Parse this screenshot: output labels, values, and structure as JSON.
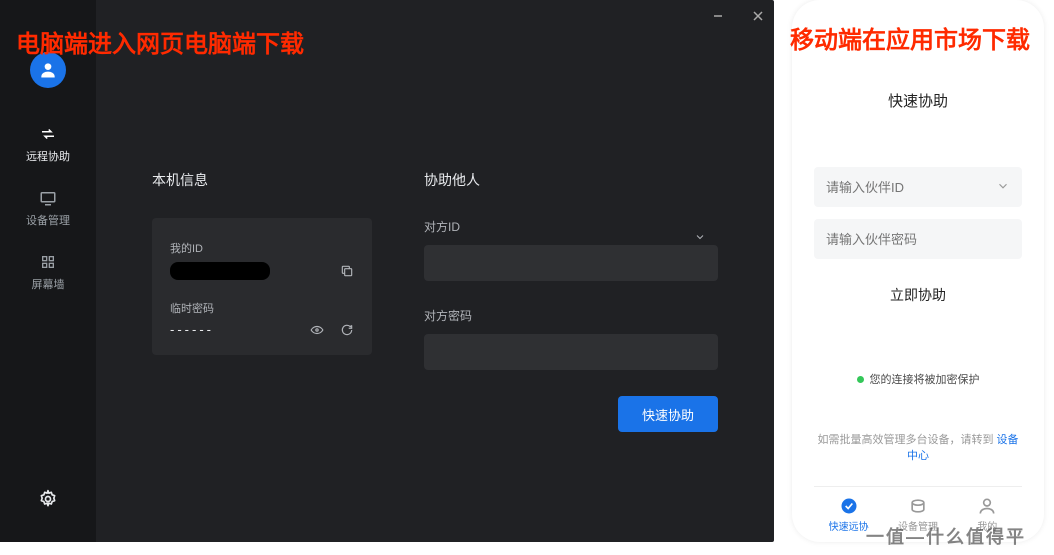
{
  "annotation": {
    "desktop": "电脑端进入网页电脑端下载",
    "mobile": "移动端在应用市场下载"
  },
  "desktop": {
    "sidebar": {
      "items": [
        {
          "label": "远程协助"
        },
        {
          "label": "设备管理"
        },
        {
          "label": "屏幕墙"
        }
      ]
    },
    "local": {
      "title": "本机信息",
      "id_label": "我的ID",
      "pwd_label": "临时密码",
      "pwd_value": "------"
    },
    "assist": {
      "title": "协助他人",
      "id_label": "对方ID",
      "pwd_label": "对方密码",
      "button": "快速协助"
    }
  },
  "mobile": {
    "title": "快速协助",
    "id_placeholder": "请输入伙伴ID",
    "pwd_placeholder": "请输入伙伴密码",
    "button": "立即协助",
    "secure": "您的连接将被加密保护",
    "note_prefix": "如需批量高效管理多台设备，请转到 ",
    "note_link": "设备中心",
    "tabs": [
      {
        "label": "快速远协"
      },
      {
        "label": "设备管理"
      },
      {
        "label": "我的"
      }
    ]
  },
  "watermark": "一值—什么值得平"
}
